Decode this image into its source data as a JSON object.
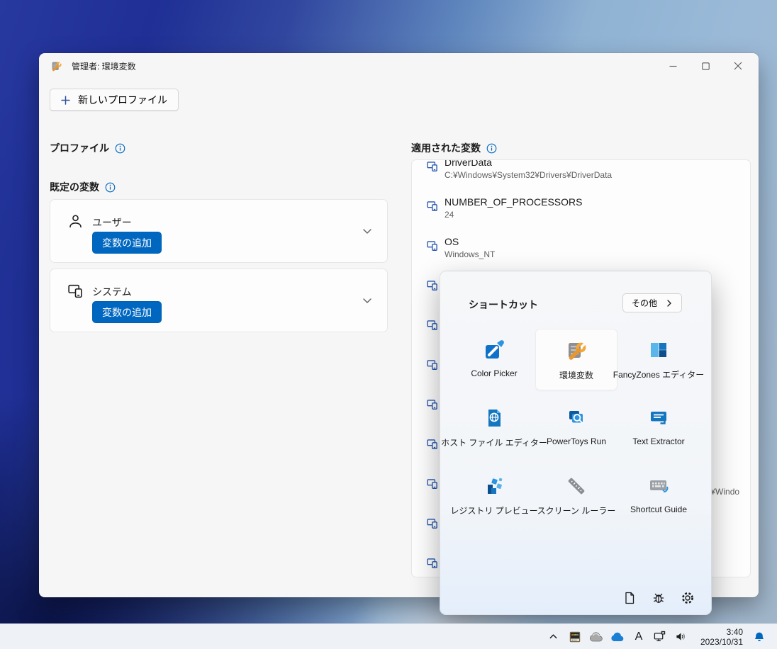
{
  "colors": {
    "accent": "#0067c0",
    "list_icon_blue": "#2456ae",
    "wrench_orange": "#ef9d2e",
    "taskbar_bg": "#eef1f6",
    "window_bg": "#f6f6f6"
  },
  "window": {
    "title": "管理者: 環境変数",
    "controls": {
      "minimize": "minimize",
      "maximize": "maximize",
      "close": "close"
    },
    "new_profile_button": "新しいプロファイル",
    "left": {
      "profiles_heading": "プロファイル",
      "defaults_heading": "既定の変数",
      "cards": [
        {
          "label": "ユーザー",
          "button": "変数の追加",
          "icon": "person"
        },
        {
          "label": "システム",
          "button": "変数の追加",
          "icon": "devices"
        }
      ]
    },
    "right": {
      "heading": "適用された変数",
      "variables": [
        {
          "name": "DriverData",
          "value": "C:¥Windows¥System32¥Drivers¥DriverData"
        },
        {
          "name": "NUMBER_OF_PROCESSORS",
          "value": "24"
        },
        {
          "name": "OS",
          "value": "Windows_NT"
        },
        {},
        {},
        {},
        {},
        {},
        {
          "fragment": "32¥Windo"
        },
        {},
        {}
      ]
    }
  },
  "flyout": {
    "title": "ショートカット",
    "more_button": "その他",
    "shortcuts": [
      {
        "label": "Color Picker",
        "icon": "color-picker-icon",
        "selected": false
      },
      {
        "label": "環境変数",
        "icon": "environment-variables-icon",
        "selected": true
      },
      {
        "label": "FancyZones エディター",
        "icon": "fancyzones-icon",
        "selected": false
      },
      {
        "label": "ホスト ファイル エディター",
        "icon": "hosts-file-editor-icon",
        "selected": false
      },
      {
        "label": "PowerToys Run",
        "icon": "powertoys-run-icon",
        "selected": false
      },
      {
        "label": "Text Extractor",
        "icon": "text-extractor-icon",
        "selected": false
      },
      {
        "label": "レジストリ プレビュー",
        "icon": "registry-preview-icon",
        "selected": false
      },
      {
        "label": "スクリーン ルーラー",
        "icon": "screen-ruler-icon",
        "selected": false
      },
      {
        "label": "Shortcut Guide",
        "icon": "shortcut-guide-icon",
        "selected": false
      }
    ],
    "footer_icons": [
      "document-icon",
      "bug-report-icon",
      "settings-gear-icon"
    ]
  },
  "taskbar": {
    "tray_icons": [
      "chevron-up-icon",
      "powertoys-tray-icon",
      "cloud-gray-icon",
      "onedrive-cloud-icon",
      "ime-letter-a",
      "network-display-icon",
      "speaker-icon"
    ],
    "ime_letter": "A",
    "time": "3:40",
    "date": "2023/10/31",
    "notification_icon": "bell-icon"
  }
}
